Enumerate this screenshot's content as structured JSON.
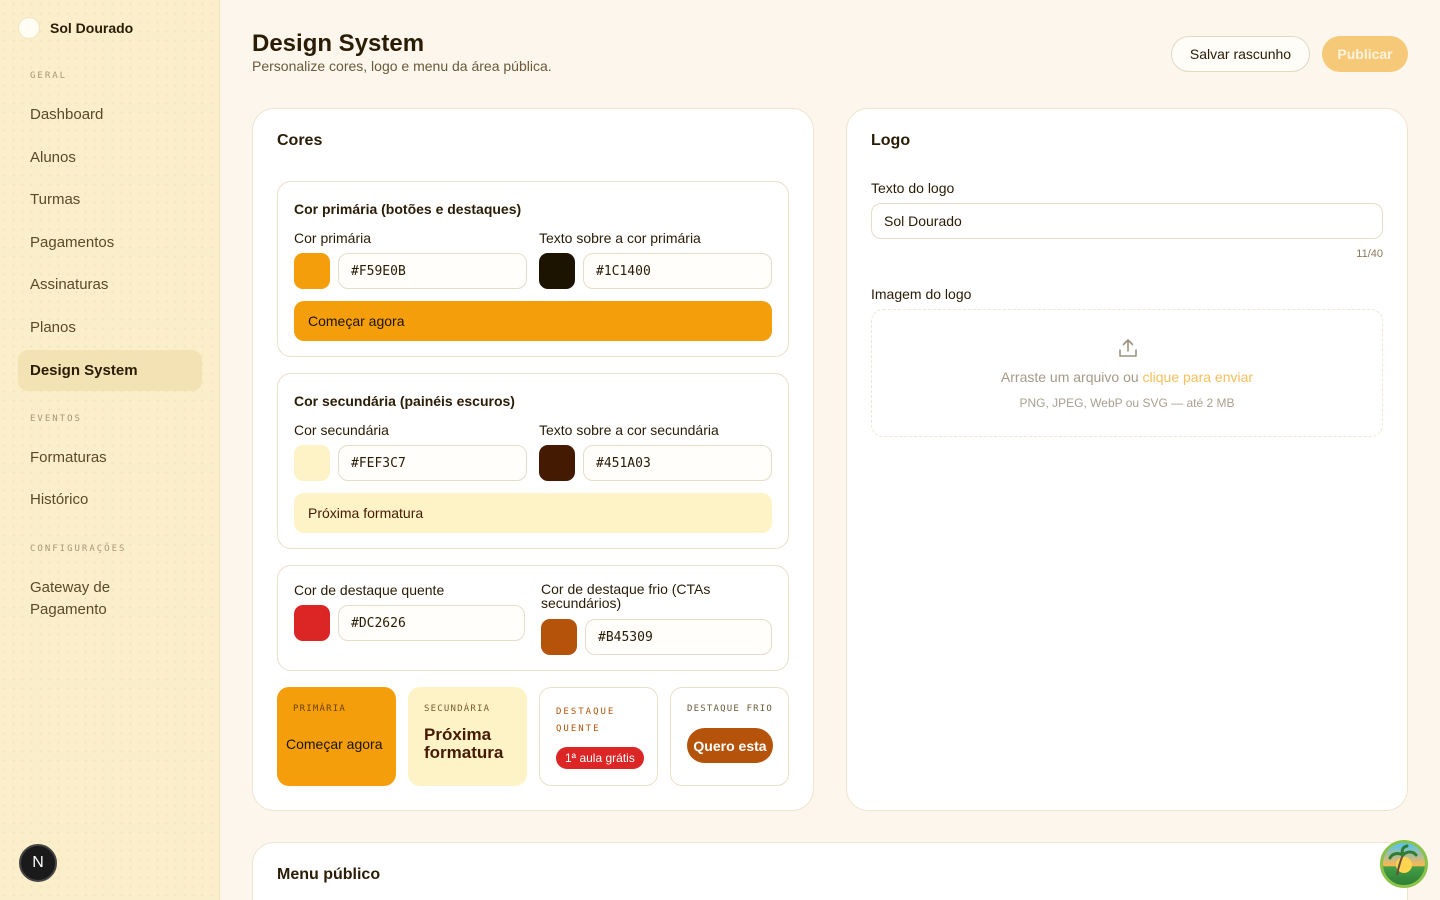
{
  "sidebar": {
    "brand": "Sol Dourado",
    "sections": {
      "geral": "GERAL",
      "eventos": "EVENTOS",
      "config": "CONFIGURAÇÕES"
    },
    "items": [
      {
        "label": "Dashboard"
      },
      {
        "label": "Alunos"
      },
      {
        "label": "Turmas"
      },
      {
        "label": "Pagamentos"
      },
      {
        "label": "Assinaturas"
      },
      {
        "label": "Planos"
      },
      {
        "label": "Design System",
        "active": true
      },
      {
        "label": "Formaturas"
      },
      {
        "label": "Histórico"
      },
      {
        "label": "Gateway de Pagamento"
      }
    ],
    "avatar_letter": "N"
  },
  "header": {
    "title": "Design System",
    "subtitle": "Personalize cores, logo e menu da área pública.",
    "draft_label": "Salvar rascunho",
    "publish_label": "Publicar"
  },
  "colors": {
    "title": "Cores",
    "primary_group": {
      "title": "Cor primária (botões e destaques)",
      "color_label": "Cor primária",
      "color_value": "#F59E0B",
      "text_label": "Texto sobre a cor primária",
      "text_value": "#1C1400",
      "preview": "Começar agora"
    },
    "secondary_group": {
      "title": "Cor secundária (painéis escuros)",
      "color_label": "Cor secundária",
      "color_value": "#FEF3C7",
      "text_label": "Texto sobre a cor secundária",
      "text_value": "#451A03",
      "preview": "Próxima formatura"
    },
    "accent_group": {
      "hot_label": "Cor de destaque quente",
      "hot_value": "#DC2626",
      "cold_label": "Cor de destaque frio (CTAs secundários)",
      "cold_value": "#B45309"
    },
    "tiles": {
      "primary_label": "PRIMÁRIA",
      "primary_text": "Começar agora",
      "secondary_label": "SECUNDÁRIA",
      "secondary_text": "Próxima formatura",
      "hot_label": "DESTAQUE QUENTE",
      "hot_badge": "1ª aula grátis",
      "cold_label": "DESTAQUE FRIO",
      "cold_button": "Quero esta"
    }
  },
  "logo": {
    "title": "Logo",
    "text_label": "Texto do logo",
    "text_value": "Sol Dourado",
    "counter": "11/40",
    "image_label": "Imagem do logo",
    "drop_text": "Arraste um arquivo ou",
    "drop_link": "clique para enviar",
    "drop_hint": "PNG, JPEG, WebP ou SVG — até 2 MB"
  },
  "menu": {
    "title": "Menu público"
  },
  "icons": {
    "upload": "upload-icon",
    "brand": "sun-logo-icon",
    "floating": "island-avatar-icon"
  }
}
